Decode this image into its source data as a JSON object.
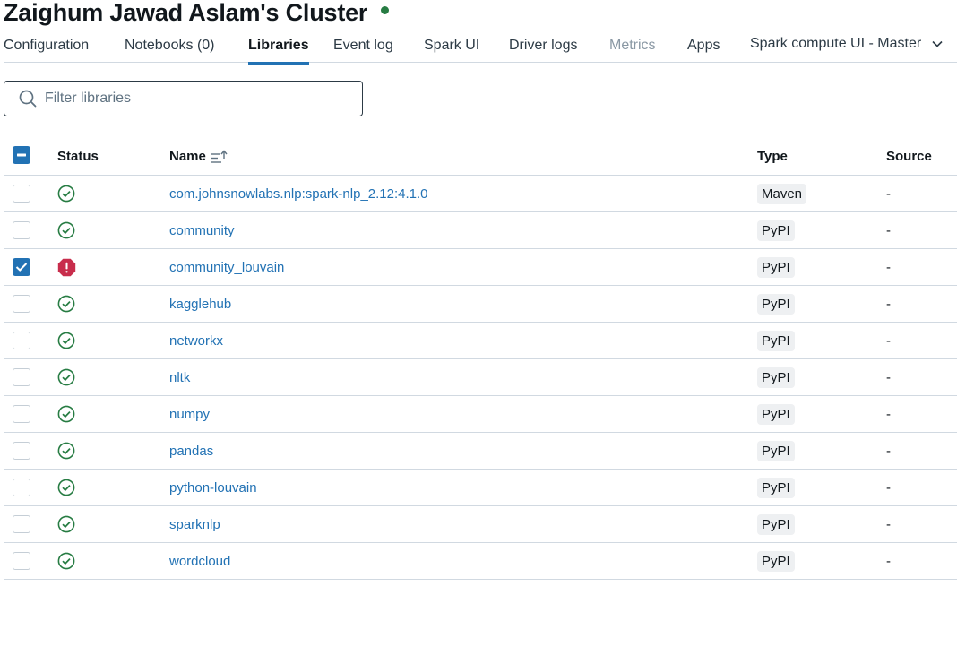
{
  "cluster": {
    "title": "Zaighum Jawad Aslam's Cluster",
    "status_color": "#277c43"
  },
  "tabs": [
    {
      "label": "Configuration",
      "state": "normal"
    },
    {
      "label": "Notebooks (0)",
      "state": "normal"
    },
    {
      "label": "Libraries",
      "state": "active"
    },
    {
      "label": "Event log",
      "state": "normal"
    },
    {
      "label": "Spark UI",
      "state": "normal"
    },
    {
      "label": "Driver logs",
      "state": "normal"
    },
    {
      "label": "Metrics",
      "state": "disabled"
    },
    {
      "label": "Apps",
      "state": "normal"
    }
  ],
  "tab_dropdown": {
    "label": "Spark compute UI - Master",
    "icon": "chevron-down-icon"
  },
  "filter": {
    "placeholder": "Filter libraries",
    "value": "",
    "icon": "search-icon"
  },
  "table": {
    "headers": {
      "status": "Status",
      "name": "Name",
      "type": "Type",
      "source": "Source"
    },
    "select_all_state": "partial",
    "rows": [
      {
        "name": "com.johnsnowlabs.nlp:spark-nlp_2.12:4.1.0",
        "status": "installed",
        "type": "Maven",
        "source": "-",
        "selected": false
      },
      {
        "name": "community",
        "status": "installed",
        "type": "PyPI",
        "source": "-",
        "selected": false
      },
      {
        "name": "community_louvain",
        "status": "failed",
        "type": "PyPI",
        "source": "-",
        "selected": true
      },
      {
        "name": "kagglehub",
        "status": "installed",
        "type": "PyPI",
        "source": "-",
        "selected": false
      },
      {
        "name": "networkx",
        "status": "installed",
        "type": "PyPI",
        "source": "-",
        "selected": false
      },
      {
        "name": "nltk",
        "status": "installed",
        "type": "PyPI",
        "source": "-",
        "selected": false
      },
      {
        "name": "numpy",
        "status": "installed",
        "type": "PyPI",
        "source": "-",
        "selected": false
      },
      {
        "name": "pandas",
        "status": "installed",
        "type": "PyPI",
        "source": "-",
        "selected": false
      },
      {
        "name": "python-louvain",
        "status": "installed",
        "type": "PyPI",
        "source": "-",
        "selected": false
      },
      {
        "name": "sparknlp",
        "status": "installed",
        "type": "PyPI",
        "source": "-",
        "selected": false
      },
      {
        "name": "wordcloud",
        "status": "installed",
        "type": "PyPI",
        "source": "-",
        "selected": false
      }
    ]
  },
  "colors": {
    "accent": "#2272b4",
    "success": "#277c43",
    "error": "#c82d4c"
  }
}
